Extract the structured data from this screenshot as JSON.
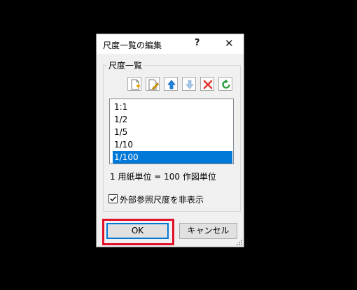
{
  "dialog": {
    "title": "尺度一覧の編集",
    "help_glyph": "?",
    "close_glyph": "✕"
  },
  "group": {
    "label": "尺度一覧"
  },
  "toolbar": {
    "buttons": [
      {
        "name": "new-scale-button",
        "icon": "new-document-icon"
      },
      {
        "name": "edit-scale-button",
        "icon": "edit-document-icon"
      },
      {
        "name": "move-up-button",
        "icon": "arrow-up-icon"
      },
      {
        "name": "move-down-button",
        "icon": "arrow-down-icon",
        "disabled": true
      },
      {
        "name": "delete-scale-button",
        "icon": "delete-x-icon"
      },
      {
        "name": "reset-button",
        "icon": "refresh-icon"
      }
    ]
  },
  "scale_list": {
    "items": [
      "1:1",
      "1/2",
      "1/5",
      "1/10",
      "1/100"
    ],
    "selected_index": 4
  },
  "unit_text": "1 用紙単位 = 100 作図単位",
  "checkbox": {
    "label": "外部参照尺度を非表示",
    "checked": true
  },
  "buttons": {
    "ok_label": "OK",
    "cancel_label": "キャンセル"
  },
  "colors": {
    "selection": "#0078d7",
    "highlight": "#e0102a",
    "up_arrow": "#1e88e5",
    "down_arrow_disabled": "#a8c8e8",
    "delete": "#e53935",
    "reset": "#2e9e3c"
  }
}
